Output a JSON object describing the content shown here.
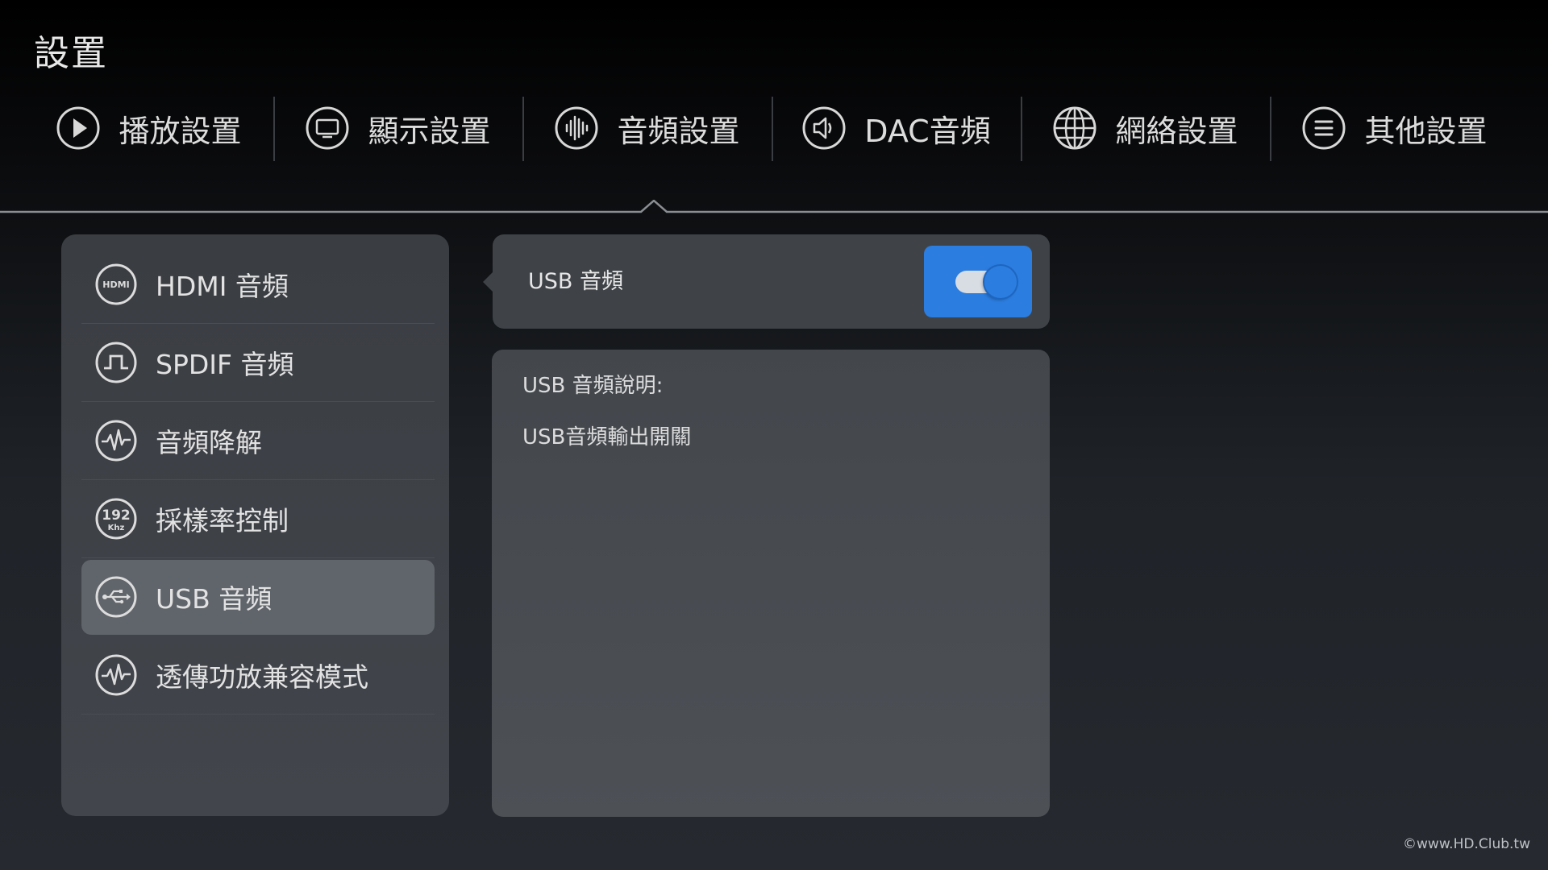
{
  "page": {
    "title": "設置"
  },
  "tabs": [
    {
      "label": "播放設置",
      "icon": "play-icon"
    },
    {
      "label": "顯示設置",
      "icon": "monitor-icon"
    },
    {
      "label": "音頻設置",
      "icon": "audio-wave-icon",
      "selected": true
    },
    {
      "label": "DAC音頻",
      "icon": "speaker-icon"
    },
    {
      "label": "網絡設置",
      "icon": "globe-icon"
    },
    {
      "label": "其他設置",
      "icon": "menu-icon"
    }
  ],
  "sidebar": {
    "items": [
      {
        "label": "HDMI 音頻",
        "icon": "hdmi-icon",
        "icon_text": "HDMI"
      },
      {
        "label": "SPDIF 音頻",
        "icon": "spdif-icon"
      },
      {
        "label": "音頻降解",
        "icon": "pulse-icon"
      },
      {
        "label": "採樣率控制",
        "icon": "sample-rate-icon",
        "icon_text": "192",
        "icon_subtext": "Khz"
      },
      {
        "label": "USB 音頻",
        "icon": "usb-icon",
        "selected": true
      },
      {
        "label": "透傳功放兼容模式",
        "icon": "pulse-icon"
      }
    ]
  },
  "usb_setting": {
    "label": "USB 音頻",
    "enabled": true
  },
  "description": {
    "title": "USB 音頻說明:",
    "text": "USB音頻輸出開關"
  },
  "watermark": "©www.HD.Club.tw",
  "colors": {
    "accent": "#2b7de0",
    "sidebar_bg": "#3d4146",
    "selected_item_bg": "#60656b"
  }
}
